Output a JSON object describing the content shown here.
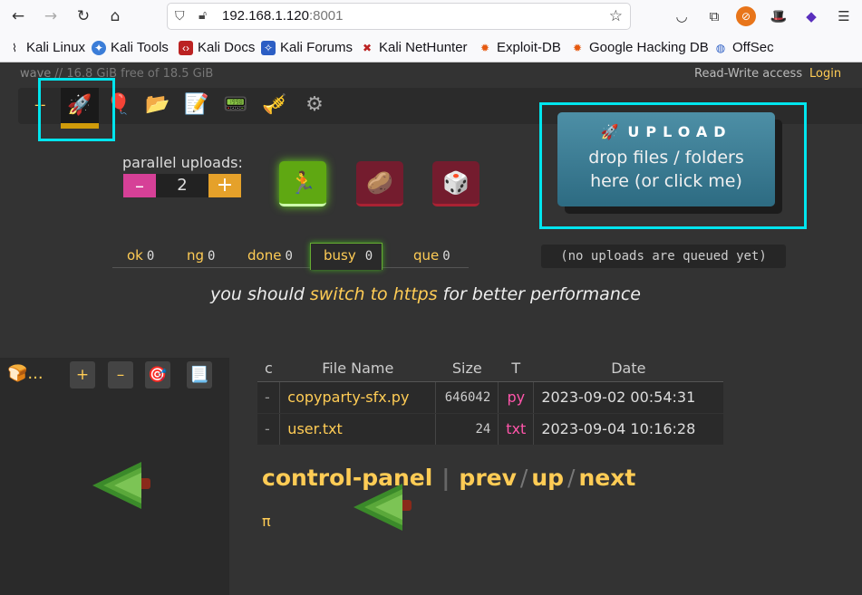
{
  "browser": {
    "url_host": "192.168.1.120",
    "url_port": ":8001",
    "bookmarks": [
      {
        "label": "Kali Linux",
        "icon": "kali-dragon-icon",
        "color": "#222"
      },
      {
        "label": "Kali Tools",
        "icon": "kali-tools-icon",
        "color": "#3a6"
      },
      {
        "label": "Kali Docs",
        "icon": "kali-docs-icon",
        "color": "#a22"
      },
      {
        "label": "Kali Forums",
        "icon": "kali-forums-icon",
        "color": "#36b"
      },
      {
        "label": "Kali NetHunter",
        "icon": "nethunter-icon",
        "color": "#a22"
      },
      {
        "label": "Exploit-DB",
        "icon": "exploit-db-icon",
        "color": "#e60"
      },
      {
        "label": "Google Hacking DB",
        "icon": "ghdb-icon",
        "color": "#e60"
      },
      {
        "label": "OffSec",
        "icon": "offsec-icon",
        "color": "#36b"
      }
    ]
  },
  "app": {
    "path_prefix": "wave",
    "path_sep": " // ",
    "disk_info": "16.8 GiB free of 18.5 GiB",
    "access": "Read-Write access",
    "login": "Login",
    "opbar_dashes": "--",
    "parallel_label": "parallel uploads:",
    "parallel_minus": "–",
    "parallel_value": "2",
    "parallel_plus": "+",
    "upload_title": "UPLOAD",
    "upload_line1": "drop files / folders",
    "upload_line2": "here (or click me)",
    "queued_msg": "(no uploads are queued yet)",
    "tabs": [
      {
        "label": "ok",
        "count": "0"
      },
      {
        "label": "ng",
        "count": "0"
      },
      {
        "label": "done",
        "count": "0"
      },
      {
        "label": "busy",
        "count": "0"
      },
      {
        "label": "que",
        "count": "0"
      }
    ],
    "https_pre": "you should",
    "https_link": "switch to https",
    "https_post": "for better performance"
  },
  "tree": {
    "crumb": "🍞...",
    "btn_plus": "+",
    "btn_minus": "–",
    "btn_target": "🎯",
    "btn_list": "📃"
  },
  "files": {
    "headers": [
      "c",
      "File Name",
      "Size",
      "T",
      "Date"
    ],
    "rows": [
      {
        "c": "-",
        "name": "copyparty-sfx.py",
        "size": "646042",
        "ext": "py",
        "date": "2023-09-02 00:54:31"
      },
      {
        "c": "-",
        "name": "user.txt",
        "size": "24",
        "ext": "txt",
        "date": "2023-09-04 10:16:28"
      }
    ]
  },
  "footer": {
    "control_panel": "control-panel",
    "divider": "|",
    "prev": "prev",
    "up": "up",
    "next": "next",
    "pi": "π"
  }
}
